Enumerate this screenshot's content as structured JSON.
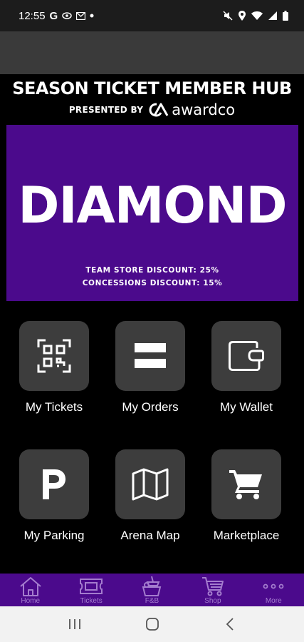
{
  "status_bar": {
    "time": "12:55",
    "left_icons": [
      "google-icon",
      "eye-icon",
      "mail-icon",
      "dot-icon"
    ],
    "right_icons": [
      "mute-icon",
      "location-icon",
      "wifi-icon",
      "signal-icon",
      "battery-icon"
    ]
  },
  "hub": {
    "title": "SEASON TICKET MEMBER HUB",
    "presented_by": "PRESENTED BY",
    "sponsor": "awardco"
  },
  "tier": {
    "name": "DIAMOND",
    "benefits": [
      "TEAM STORE DISCOUNT: 25%",
      "CONCESSIONS DISCOUNT: 15%"
    ]
  },
  "tiles": [
    {
      "label": "My Tickets",
      "icon": "qr-code-icon"
    },
    {
      "label": "My Orders",
      "icon": "orders-icon"
    },
    {
      "label": "My Wallet",
      "icon": "wallet-icon"
    },
    {
      "label": "My Parking",
      "icon": "parking-icon"
    },
    {
      "label": "Arena Map",
      "icon": "map-icon"
    },
    {
      "label": "Marketplace",
      "icon": "cart-icon"
    }
  ],
  "bottom_nav": [
    {
      "label": "Home",
      "icon": "home-icon"
    },
    {
      "label": "Tickets",
      "icon": "ticket-icon"
    },
    {
      "label": "F&B",
      "icon": "food-icon"
    },
    {
      "label": "Shop",
      "icon": "cart-icon"
    },
    {
      "label": "More",
      "icon": "more-icon"
    }
  ],
  "colors": {
    "brand_purple": "#4b0a8c",
    "nav_icon": "#a47cce",
    "tile_bg": "#3d3d3d"
  },
  "system_nav": [
    "recents-button",
    "home-button",
    "back-button"
  ]
}
